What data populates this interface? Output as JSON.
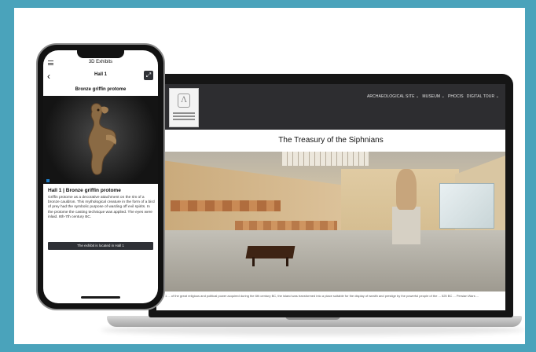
{
  "website": {
    "nav": [
      "ARCHAEOLOGICAL SITE ⌄",
      "MUSEUM ⌄",
      "PHOCIS",
      "DIGITAL TOUR ⌄"
    ],
    "page_title": "The Treasury of the Siphnians",
    "caption": "Hall 1 ... of the great religious and political power acquired during the 6th century BC, the island was transformed into a place suitable for the display of wealth and prestige by the powerful people of the ... 525 BC ... Persian Wars ..."
  },
  "app": {
    "title": "3D Exhibits",
    "hall": "Hall 1",
    "exhibit_name": "Bronze griffin protome",
    "info_title": "Hall 1 | Bronze griffin protome",
    "description": "Griffin protome as a decorative attachment on the rim of a bronze cauldron. This mythological creature in the form of a bird of prey had the symbolic purpose of warding off evil spirits. In the protome the casting technique was applied. The eyes were inlaid. 8th-7th century BC.",
    "location_button": "The exhibit is located in Hall 1"
  },
  "colors": {
    "background": "#4aa3bb",
    "header_bar": "#2d2d30",
    "button_dark": "#2f3136",
    "accent_blue": "#1e7cc4"
  },
  "icons": {
    "menu": "hamburger-icon",
    "back": "chevron-left-icon",
    "expand": "expand-icon"
  }
}
